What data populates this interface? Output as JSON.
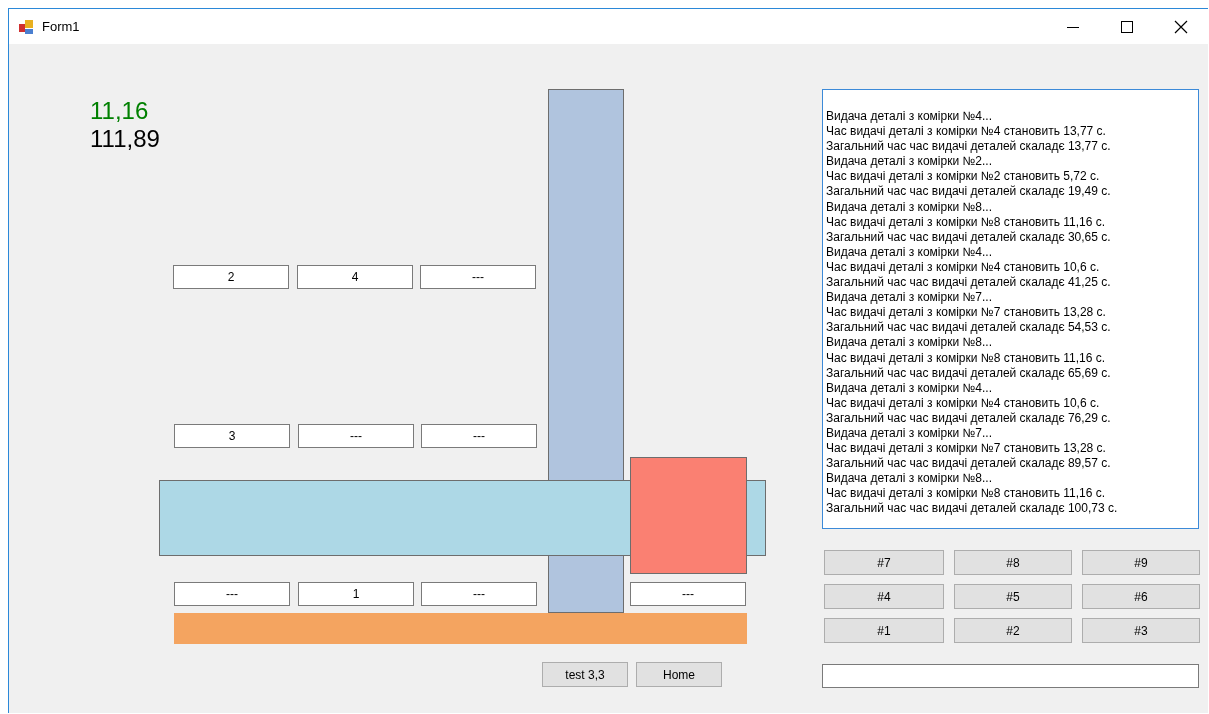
{
  "window": {
    "title": "Form1"
  },
  "readings": [
    {
      "text": "11,16",
      "color": "#008000"
    },
    {
      "text": "111,89",
      "color": "#000000"
    }
  ],
  "cells": [
    {
      "text": "2"
    },
    {
      "text": "4"
    },
    {
      "text": "---"
    },
    {
      "text": "3"
    },
    {
      "text": "---"
    },
    {
      "text": "---"
    },
    {
      "text": "---"
    },
    {
      "text": "1"
    },
    {
      "text": "---"
    },
    {
      "text": "---"
    }
  ],
  "buttons": [
    "test 3,3",
    "Home"
  ],
  "log": [
    "Видача деталі з комірки №4...",
    "Час видачі деталі з комірки №4 становить 13,77 с.",
    "Загальний час час видачі деталей скаладє 13,77 с.",
    "Видача деталі з комірки №2...",
    "Час видачі деталі з комірки №2 становить 5,72 с.",
    "Загальний час час видачі деталей скаладє 19,49 с.",
    "Видача деталі з комірки №8...",
    "Час видачі деталі з комірки №8 становить 11,16 с.",
    "Загальний час час видачі деталей скаладє 30,65 с.",
    "Видача деталі з комірки №4...",
    "Час видачі деталі з комірки №4 становить 10,6 с.",
    "Загальний час час видачі деталей скаладє 41,25 с.",
    "Видача деталі з комірки №7...",
    "Час видачі деталі з комірки №7 становить 13,28 с.",
    "Загальний час час видачі деталей скаладє 54,53 с.",
    "Видача деталі з комірки №8...",
    "Час видачі деталі з комірки №8 становить 11,16 с.",
    "Загальний час час видачі деталей скаладє 65,69 с.",
    "Видача деталі з комірки №4...",
    "Час видачі деталі з комірки №4 становить 10,6 с.",
    "Загальний час час видачі деталей скаладє 76,29 с.",
    "Видача деталі з комірки №7...",
    "Час видачі деталі з комірки №7 становить 13,28 с.",
    "Загальний час час видачі деталей скаладє 89,57 с.",
    "Видача деталі з комірки №8...",
    "Час видачі деталі з комірки №8 становить 11,16 с.",
    "Загальний час час видачі деталей скаладє 100,73 с."
  ],
  "keypad": [
    "#7",
    "#8",
    "#9",
    "#4",
    "#5",
    "#6",
    "#1",
    "#2",
    "#3"
  ]
}
